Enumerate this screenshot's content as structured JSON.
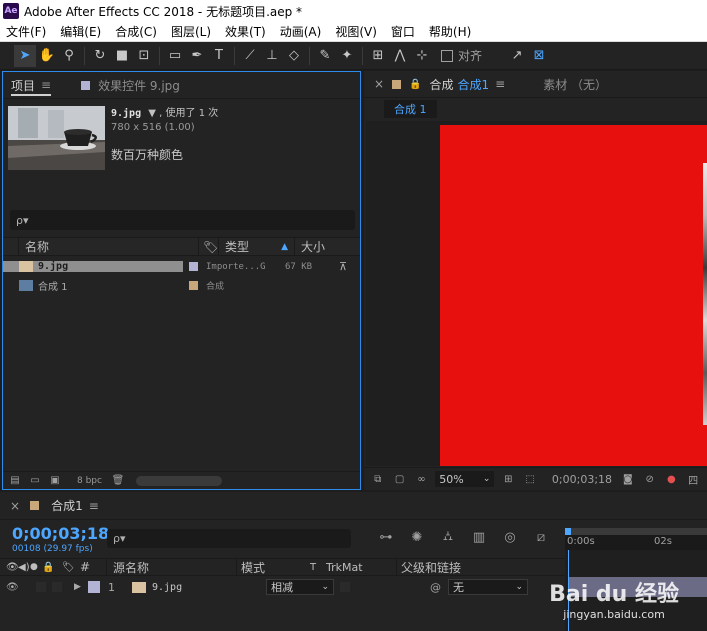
{
  "window": {
    "title": "Adobe After Effects CC 2018 - 无标题项目.aep *",
    "app_icon": "Ae"
  },
  "menu": [
    "文件(F)",
    "编辑(E)",
    "合成(C)",
    "图层(L)",
    "效果(T)",
    "动画(A)",
    "视图(V)",
    "窗口",
    "帮助(H)"
  ],
  "toolbar": {
    "align_label": "对齐"
  },
  "project": {
    "tab_label": "项目",
    "effects_tab_label": "效果控件 9.jpg",
    "selected_name": "9.jpg",
    "used_text": "▼ , 使用了 1 次",
    "dimensions": "780 x 516 (1.00)",
    "colors": "数百万种颜色",
    "search_placeholder": "ρ▾",
    "columns": {
      "name": "名称",
      "type": "类型",
      "size": "大小"
    },
    "items": [
      {
        "name": "9.jpg",
        "type": "Importe...G",
        "size": "67 KB",
        "color": "#b3b3d6"
      },
      {
        "name": "合成 1",
        "type": "合成",
        "size": "",
        "color": "#c8a87a"
      }
    ],
    "bpc": "8 bpc"
  },
  "composition": {
    "tab_label": "合成",
    "tab_comp": "合成1",
    "footage_tab": "素材 （无）",
    "subtab": "合成 1",
    "zoom": "50%",
    "timecode": "0;00;03;18",
    "red": "#e8100f"
  },
  "timeline": {
    "tab_label": "合成1",
    "timecode": "0;00;03;18",
    "frames": "00108 (29.97 fps)",
    "search_placeholder": "ρ▾",
    "ruler": [
      "0:00s",
      "02s"
    ],
    "headers": {
      "hash": "#",
      "source": "源名称",
      "mode": "模式",
      "t": "T",
      "trkmat": "TrkMat",
      "parent": "父级和链接"
    },
    "layer": {
      "index": "1",
      "name": "9.jpg",
      "mode": "相减",
      "parent": "无"
    }
  },
  "watermark": {
    "line1": "Bai du 经验",
    "line2": "jingyan.baidu.com"
  }
}
